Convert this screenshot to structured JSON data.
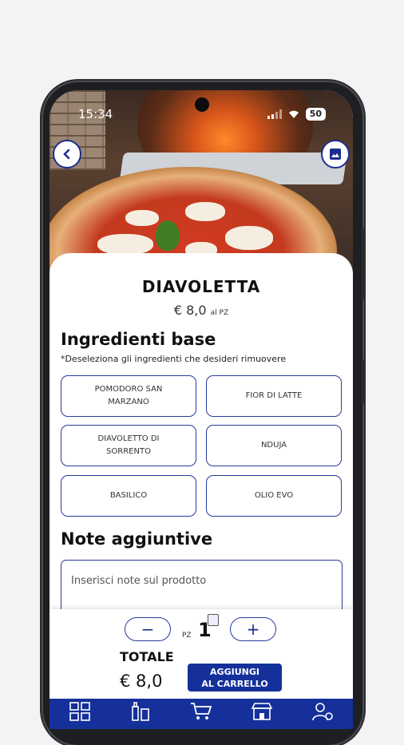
{
  "status_bar": {
    "time": "15:34",
    "battery": "50"
  },
  "product": {
    "name": "DIAVOLETTA",
    "price": "€ 8,0",
    "price_unit": "al PZ"
  },
  "ingredients": {
    "title": "Ingredienti base",
    "hint": "*Deseleziona gli ingredienti che desideri rimuovere",
    "items": [
      {
        "label": "POMODORO SAN MARZANO"
      },
      {
        "label": "FIOR DI LATTE"
      },
      {
        "label": "DIAVOLETTO DI SORRENTO"
      },
      {
        "label": "NDUJA"
      },
      {
        "label": "BASILICO"
      },
      {
        "label": "OLIO EVO"
      }
    ]
  },
  "notes": {
    "title": "Note aggiuntive",
    "placeholder": "Inserisci note sul prodotto"
  },
  "cart": {
    "minus": "−",
    "plus": "+",
    "unit": "PZ",
    "quantity": "1",
    "total_label": "TOTALE",
    "total_value": "€ 8,0",
    "add_line1": "AGGIUNGI",
    "add_line2": "AL CARRELLO"
  },
  "tabbar": {
    "items": [
      {
        "icon": "menu-grid-icon"
      },
      {
        "icon": "drinks-icon"
      },
      {
        "icon": "cart-icon"
      },
      {
        "icon": "store-icon"
      },
      {
        "icon": "user-settings-icon"
      }
    ]
  },
  "colors": {
    "accent": "#15309a",
    "border": "#2a3a9b"
  }
}
